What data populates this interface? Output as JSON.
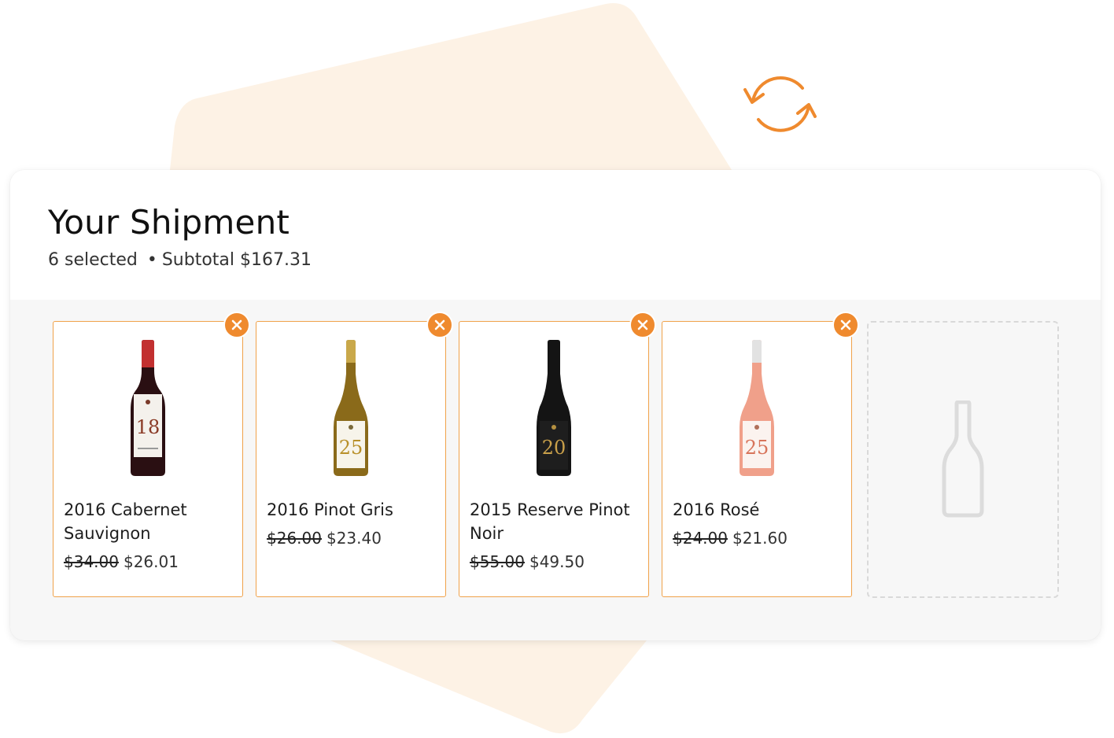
{
  "colors": {
    "accent": "#ef8a2e",
    "card_border": "#f0a24a",
    "bg_shape": "#fdf2e5",
    "panel_body": "#f7f7f7"
  },
  "header": {
    "title": "Your Shipment",
    "selected_count": "6 selected",
    "separator": "•",
    "subtotal": "Subtotal $167.31"
  },
  "icons": {
    "refresh": "refresh-icon",
    "remove": "close-icon",
    "empty": "bottle-outline-icon"
  },
  "items": [
    {
      "name": "2016 Cabernet Sauvignon",
      "old_price": "$34.00",
      "new_price": "$26.01",
      "label_number": "18",
      "bottle": "red"
    },
    {
      "name": "2016 Pinot Gris",
      "old_price": "$26.00",
      "new_price": "$23.40",
      "label_number": "25",
      "bottle": "white"
    },
    {
      "name": "2015 Reserve Pinot Noir",
      "old_price": "$55.00",
      "new_price": "$49.50",
      "label_number": "20",
      "bottle": "black"
    },
    {
      "name": "2016 Rosé",
      "old_price": "$24.00",
      "new_price": "$21.60",
      "label_number": "25",
      "bottle": "rose"
    }
  ]
}
